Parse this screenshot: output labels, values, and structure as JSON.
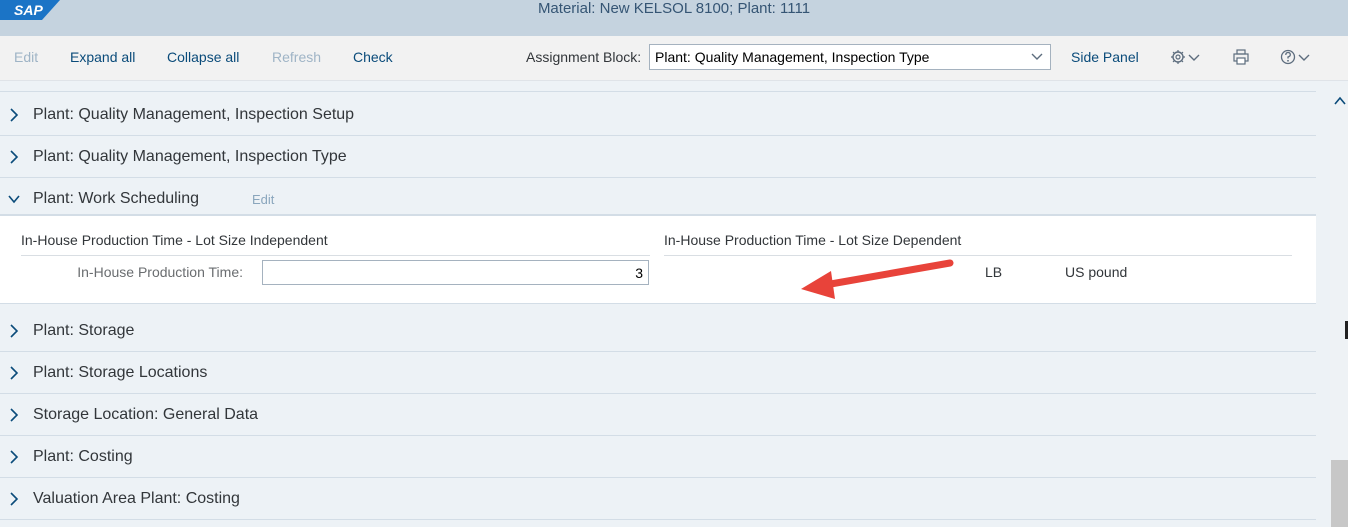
{
  "shell": {
    "logo_text": "SAP",
    "title": "Material: New KELSOL 8100; Plant: 1111"
  },
  "toolbar": {
    "edit": "Edit",
    "expand_all": "Expand all",
    "collapse_all": "Collapse all",
    "refresh": "Refresh",
    "check": "Check",
    "assignment_block_label": "Assignment Block:",
    "assignment_block_value": "Plant: Quality Management, Inspection Type",
    "side_panel": "Side Panel",
    "icons": [
      "settings-gear-icon",
      "print-icon",
      "help-icon"
    ]
  },
  "sections_top": [
    {
      "title": "Plant: Quality Management, Inspection Setup"
    },
    {
      "title": "Plant: Quality Management, Inspection Type"
    },
    {
      "title": "Plant: Work Scheduling",
      "edit_label": "Edit",
      "expanded": true
    }
  ],
  "work_scheduling": {
    "group_independent": "In-House Production Time - Lot Size Independent",
    "group_dependent": "In-House Production Time - Lot Size Dependent",
    "field_label": "In-House Production Time:",
    "field_value": "3",
    "uom_code": "LB",
    "uom_text": "US pound"
  },
  "sections_bottom": [
    {
      "title": "Plant: Storage"
    },
    {
      "title": "Plant: Storage Locations"
    },
    {
      "title": "Storage Location: General Data"
    },
    {
      "title": "Plant: Costing"
    },
    {
      "title": "Valuation Area Plant: Costing"
    }
  ],
  "colors": {
    "shell_bg": "#c5d3df",
    "link": "#0a4b7a",
    "annotation_arrow": "#e8433a"
  }
}
